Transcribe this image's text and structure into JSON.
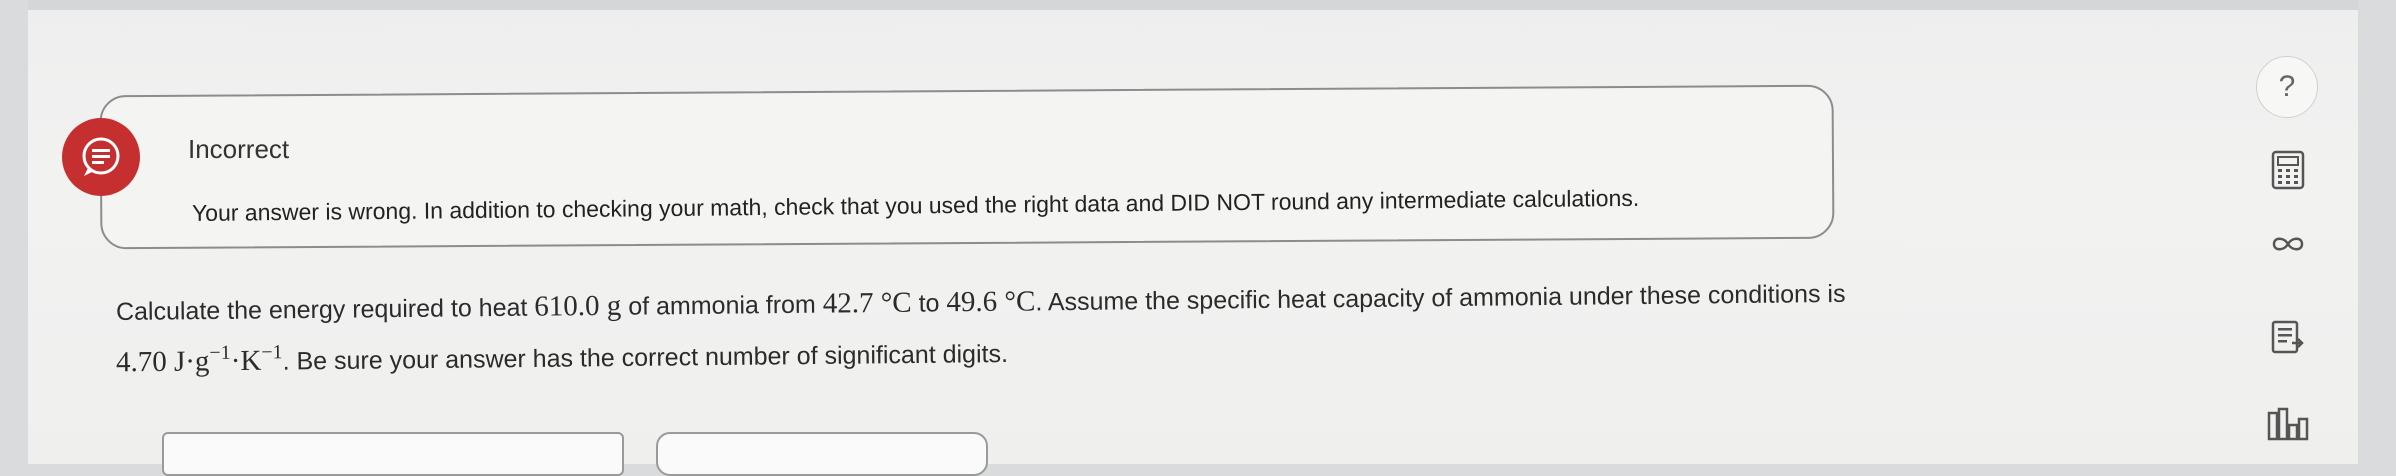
{
  "feedback": {
    "title": "Incorrect",
    "message": "Your answer is wrong. In addition to checking your math, check that you used the right data and DID NOT round any intermediate calculations.",
    "icon": "chat-bubble-icon",
    "accent_color": "#c62f2f"
  },
  "question": {
    "t1": "Calculate the energy required to heat ",
    "mass": "610.0 g",
    "t2": " of ammonia from ",
    "temp1": "42.7 °C",
    "t3": " to ",
    "temp2": "49.6 °C",
    "t4": ". Assume the specific heat capacity of ammonia under these conditions is",
    "cp_value": "4.70 J·g",
    "exp1": "−1",
    "k_unit": "·K",
    "exp2": "−1",
    "t5": ". Be sure your answer has the correct number of significant digits."
  },
  "tools": {
    "help_label": "?",
    "items": [
      "calculator-icon",
      "infinity-icon",
      "data-reference-icon",
      "periodic-table-icon"
    ]
  }
}
